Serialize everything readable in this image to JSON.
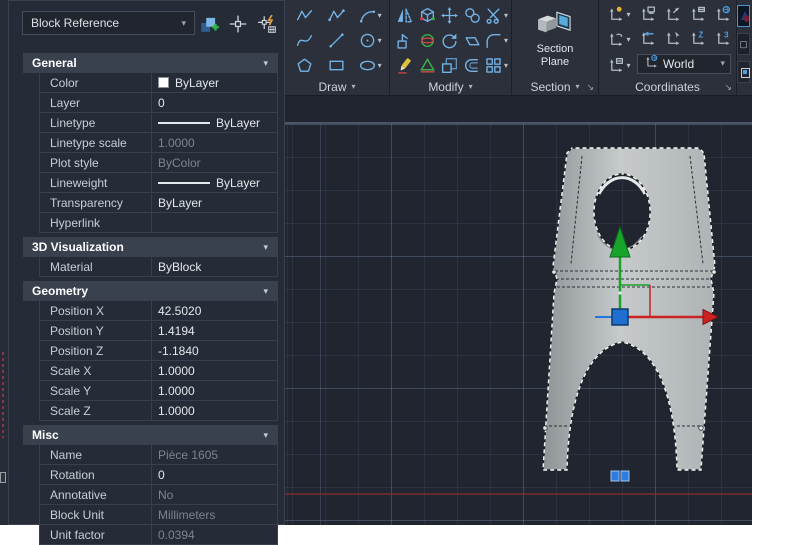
{
  "palette": {
    "type_selector": "Block Reference",
    "header_icons": [
      "toggle-pickadd",
      "select-objects",
      "quick-select"
    ],
    "sections": [
      {
        "title": "General",
        "rows": [
          {
            "label": "Color",
            "value": "ByLayer",
            "kind": "swatch",
            "muted": false,
            "editable": true
          },
          {
            "label": "Layer",
            "value": "0",
            "kind": "plain",
            "muted": false,
            "editable": true
          },
          {
            "label": "Linetype",
            "value": "ByLayer",
            "kind": "linetype",
            "muted": false,
            "editable": true
          },
          {
            "label": "Linetype scale",
            "value": "1.0000",
            "kind": "plain",
            "muted": true,
            "editable": false
          },
          {
            "label": "Plot style",
            "value": "ByColor",
            "kind": "plain",
            "muted": true,
            "editable": false
          },
          {
            "label": "Lineweight",
            "value": "ByLayer",
            "kind": "linetype",
            "muted": false,
            "editable": true
          },
          {
            "label": "Transparency",
            "value": "ByLayer",
            "kind": "plain",
            "muted": false,
            "editable": true
          },
          {
            "label": "Hyperlink",
            "value": "",
            "kind": "plain",
            "muted": false,
            "editable": true
          }
        ]
      },
      {
        "title": "3D Visualization",
        "rows": [
          {
            "label": "Material",
            "value": "ByBlock",
            "kind": "plain",
            "muted": false,
            "editable": true
          }
        ]
      },
      {
        "title": "Geometry",
        "rows": [
          {
            "label": "Position X",
            "value": "42.5020",
            "kind": "plain",
            "muted": false,
            "editable": true
          },
          {
            "label": "Position Y",
            "value": "1.4194",
            "kind": "plain",
            "muted": false,
            "editable": true
          },
          {
            "label": "Position Z",
            "value": "-1.1840",
            "kind": "plain",
            "muted": false,
            "editable": true
          },
          {
            "label": "Scale X",
            "value": "1.0000",
            "kind": "plain",
            "muted": false,
            "editable": true
          },
          {
            "label": "Scale Y",
            "value": "1.0000",
            "kind": "plain",
            "muted": false,
            "editable": true
          },
          {
            "label": "Scale Z",
            "value": "1.0000",
            "kind": "plain",
            "muted": false,
            "editable": true
          }
        ]
      },
      {
        "title": "Misc",
        "rows": [
          {
            "label": "Name",
            "value": "Pièce 1605",
            "kind": "plain",
            "muted": true,
            "editable": false
          },
          {
            "label": "Rotation",
            "value": "0",
            "kind": "plain",
            "muted": false,
            "editable": true
          },
          {
            "label": "Annotative",
            "value": "No",
            "kind": "plain",
            "muted": true,
            "editable": false
          },
          {
            "label": "Block Unit",
            "value": "Millimeters",
            "kind": "plain",
            "muted": true,
            "editable": false
          },
          {
            "label": "Unit factor",
            "value": "0.0394",
            "kind": "plain",
            "muted": true,
            "editable": false
          }
        ]
      }
    ]
  },
  "ribbon": {
    "panels": [
      {
        "label": "Draw",
        "icon_rows": [
          [
            {
              "icon": "polyline"
            },
            {
              "icon": "polyline-3d"
            },
            {
              "icon": "arc",
              "caret": true
            }
          ],
          [
            {
              "icon": "spline"
            },
            {
              "icon": "line"
            },
            {
              "icon": "circle",
              "caret": true
            }
          ],
          [
            {
              "icon": "polygon"
            },
            {
              "icon": "rectangle"
            },
            {
              "icon": "ellipse",
              "caret": true
            }
          ]
        ]
      },
      {
        "label": "Modify",
        "icon_rows": [
          [
            {
              "icon": "mirror"
            },
            {
              "icon": "align-3d"
            },
            {
              "icon": "move"
            },
            {
              "icon": "copy"
            },
            {
              "icon": "trim",
              "caret": true
            }
          ],
          [
            {
              "icon": "presspull"
            },
            {
              "icon": "rotate-3d"
            },
            {
              "icon": "rotate"
            },
            {
              "icon": "stretch"
            },
            {
              "icon": "fillet",
              "caret": true
            }
          ],
          [
            {
              "icon": "erase"
            },
            {
              "icon": "explode"
            },
            {
              "icon": "scale"
            },
            {
              "icon": "offset"
            },
            {
              "icon": "array",
              "caret": true
            }
          ]
        ]
      },
      {
        "label": "Section",
        "button": "Section Plane"
      },
      {
        "label": "Coordinates",
        "left_column": [
          {
            "icon": "ucs-show",
            "caret": true
          },
          {
            "icon": "ucs-rotate",
            "caret": true
          },
          {
            "icon": "ucs-apply",
            "caret": true
          }
        ],
        "grid_rows": [
          [
            {
              "icon": "ucs-named"
            },
            {
              "icon": "ucs-view"
            },
            {
              "icon": "ucs-object"
            },
            {
              "icon": "ucs-world"
            }
          ],
          [
            {
              "icon": "ucs-previous"
            },
            {
              "icon": "ucs-origin"
            },
            {
              "icon": "ucs-z"
            },
            {
              "icon": "ucs-3point"
            }
          ]
        ],
        "ucs_dropdown": "World"
      }
    ]
  },
  "colors": {
    "ribbon_icon_blue": "#74b3e5",
    "viewport_background": "#20252f",
    "gizmo_y_green": "#18a32a",
    "gizmo_x_red": "#cc2222",
    "gizmo_origin_blue": "#1f6fd0",
    "grip_blue": "#2f7de0",
    "axis_line_red": "#8b2e2e",
    "selection_dash": "#ffffff",
    "block_gray": "#b8bcbd"
  }
}
